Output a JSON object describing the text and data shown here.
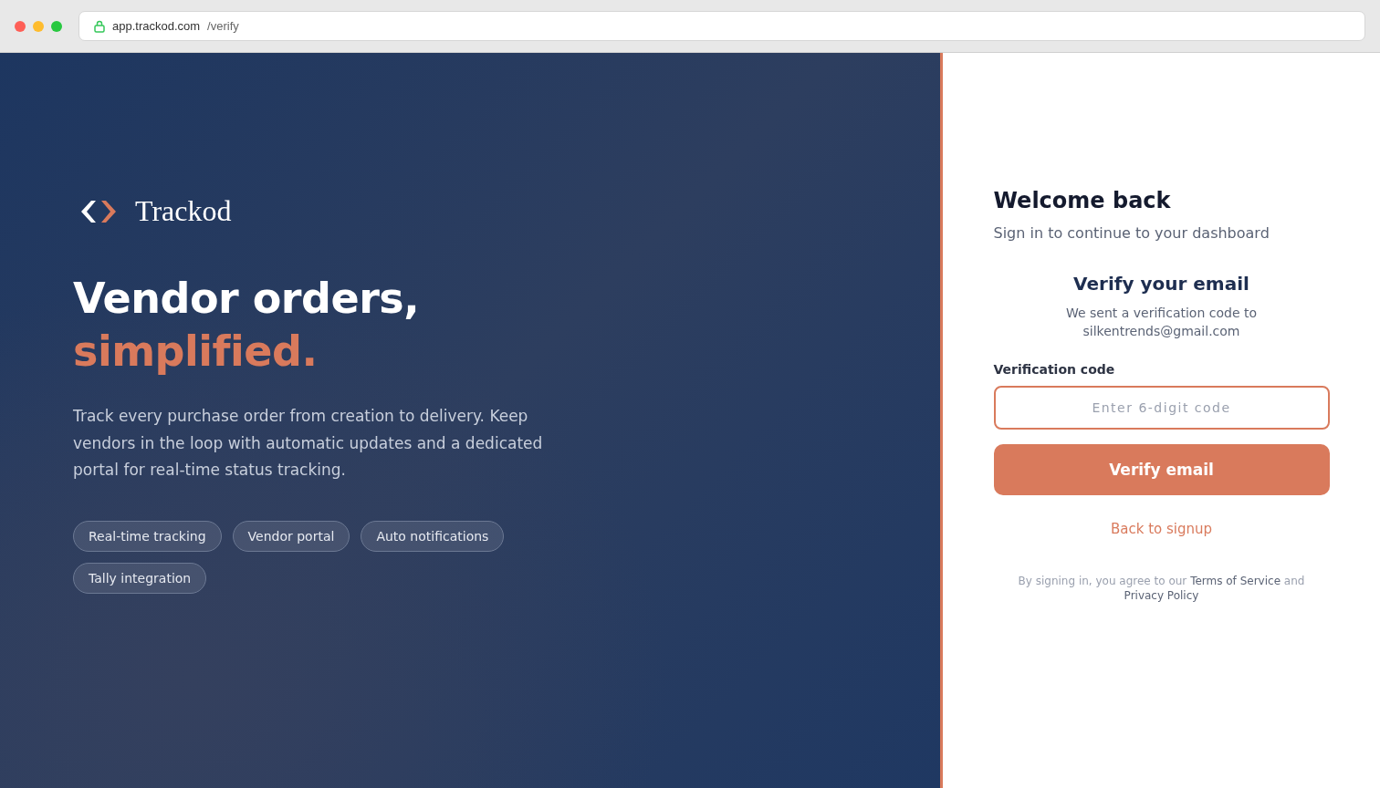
{
  "browser": {
    "host": "app.trackod.com",
    "path": "/verify"
  },
  "brand": {
    "name": "Trackod"
  },
  "hero": {
    "headline": "Vendor orders,",
    "highlight": "simplified.",
    "description": "Track every purchase order from creation to delivery. Keep vendors in the loop with automatic updates and a dedicated portal for real-time status tracking."
  },
  "features": [
    "Real-time tracking",
    "Vendor portal",
    "Auto notifications",
    "Tally integration"
  ],
  "auth": {
    "title": "Welcome back",
    "subtitle": "Sign in to continue to your dashboard",
    "verify_title": "Verify your email",
    "verify_text": "We sent a verification code to",
    "email": "silkentrends@gmail.com",
    "code_label": "Verification code",
    "code_placeholder": "Enter 6-digit code",
    "submit": "Verify email",
    "back_link": "Back to signup",
    "legal": {
      "before": "By signing in, you agree to our",
      "terms": "Terms of Service",
      "middle": "and",
      "privacy": "Privacy Policy"
    }
  }
}
